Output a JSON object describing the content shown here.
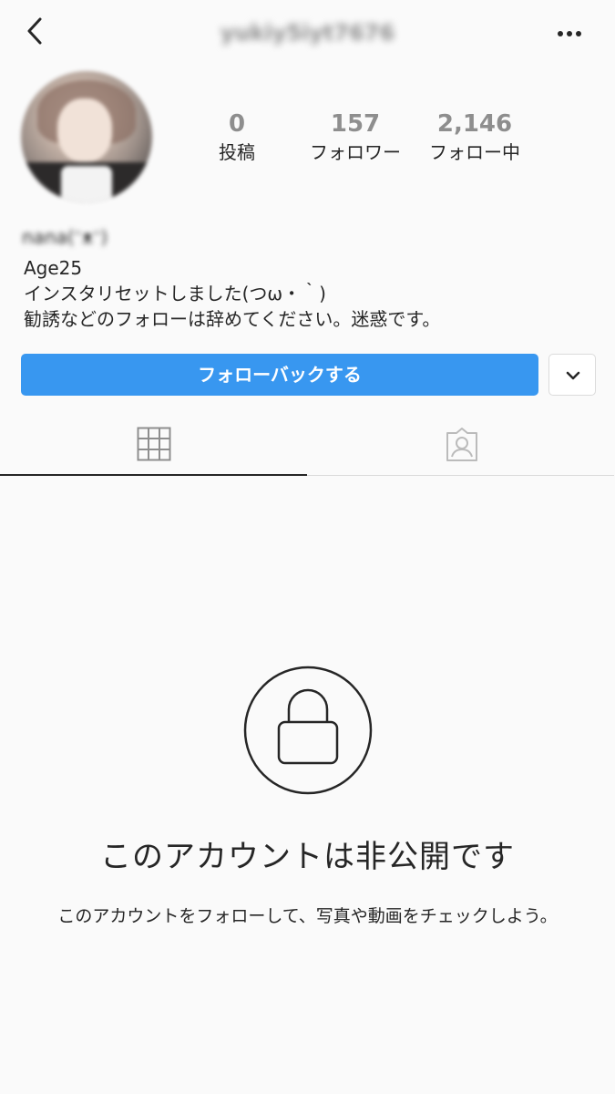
{
  "header": {
    "username": "yukiy5iyt7676",
    "back_icon": "chevron-left-icon",
    "more_icon": "more-dots-icon"
  },
  "stats": {
    "posts": {
      "count": "0",
      "label": "投稿"
    },
    "followers": {
      "count": "157",
      "label": "フォロワー"
    },
    "following": {
      "count": "2,146",
      "label": "フォロー中"
    }
  },
  "profile": {
    "display_name": "nana(ᵔᴥᵔ)",
    "bio_lines": [
      "Age25",
      "インスタリセットしました(つω・｀)",
      "勧誘などのフォローは辞めてください。迷惑です。"
    ]
  },
  "actions": {
    "follow_back_label": "フォローバックする",
    "dropdown_icon": "chevron-down-icon"
  },
  "tabs": [
    {
      "name": "grid",
      "icon": "grid-icon"
    },
    {
      "name": "tagged",
      "icon": "tagged-person-icon"
    }
  ],
  "private_notice": {
    "icon": "lock-icon",
    "title": "このアカウントは非公開です",
    "description": "このアカウントをフォローして、写真や動画をチェックしよう。"
  },
  "colors": {
    "accent": "#3897f0",
    "text": "#262626",
    "muted": "#8e8e8e",
    "background": "#fafafa",
    "border": "#dbdbdb"
  }
}
